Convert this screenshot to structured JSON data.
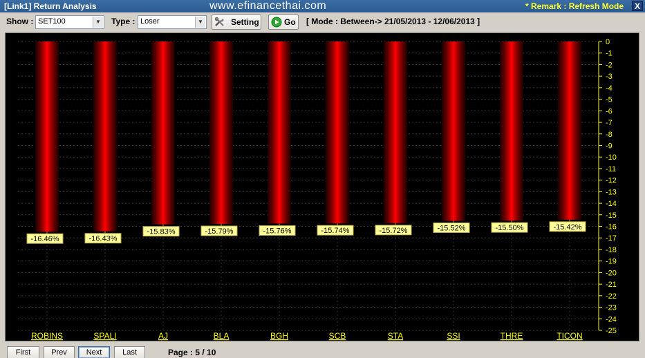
{
  "window": {
    "title": "[Link1] Return Analysis",
    "watermark": "www.efinancethai.com",
    "remark": "* Remark : Refresh Mode",
    "close_label": "X"
  },
  "toolbar": {
    "show_label": "Show :",
    "show_value": "SET100",
    "type_label": "Type :",
    "type_value": "Loser",
    "setting_label": "Setting",
    "go_label": "Go",
    "mode_text": "[ Mode : Between-> 21/05/2013 - 12/06/2013 ]"
  },
  "colors": {
    "bar": "#ff0000",
    "label_bg": "#ffff99",
    "category_text": "#ffff00",
    "axis_text": "#ffff00",
    "background": "#000000"
  },
  "chart_data": {
    "type": "bar",
    "categories": [
      "ROBINS",
      "SPALI",
      "AJ",
      "BLA",
      "BGH",
      "SCB",
      "STA",
      "SSI",
      "THRE",
      "TICON"
    ],
    "values": [
      -16.46,
      -16.43,
      -15.83,
      -15.79,
      -15.76,
      -15.74,
      -15.72,
      -15.52,
      -15.5,
      -15.42
    ],
    "value_labels": [
      "-16.46%",
      "-16.43%",
      "-15.83%",
      "-15.79%",
      "-15.76%",
      "-15.74%",
      "-15.72%",
      "-15.52%",
      "-15.50%",
      "-15.42%"
    ],
    "ylim": [
      -25,
      0
    ],
    "yticks": [
      0,
      -1,
      -2,
      -3,
      -4,
      -5,
      -6,
      -7,
      -8,
      -9,
      -10,
      -11,
      -12,
      -13,
      -14,
      -15,
      -16,
      -17,
      -18,
      -19,
      -20,
      -21,
      -22,
      -23,
      -24,
      -25
    ],
    "grid": true,
    "axis_position": "right"
  },
  "nav": {
    "first": "First",
    "prev": "Prev",
    "next": "Next",
    "last": "Last",
    "page_info": "Page : 5 / 10"
  }
}
